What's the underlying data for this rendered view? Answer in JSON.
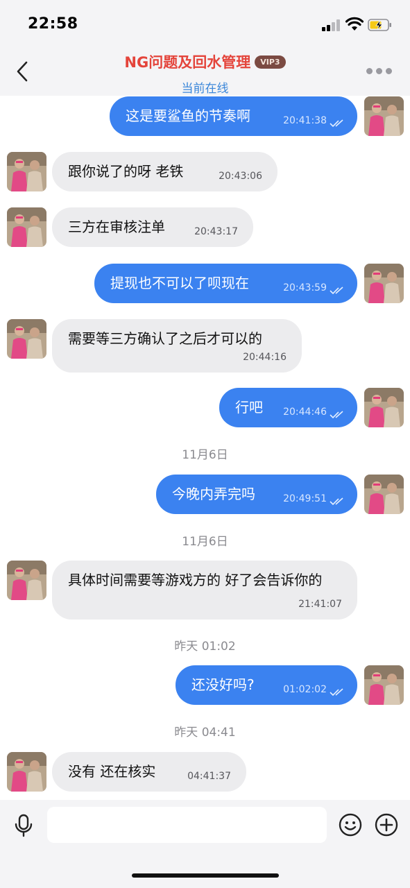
{
  "status_bar": {
    "time": "22:58"
  },
  "header": {
    "title": "NG问题及回水管理",
    "badge": "VIP3",
    "subtitle": "当前在线"
  },
  "messages": [
    {
      "side": "out",
      "text": "这是要鲨鱼的节奏啊",
      "time": "20:41:38",
      "status_icon": "double-check-icon"
    },
    {
      "side": "in",
      "text": "跟你说了的呀  老铁",
      "time": "20:43:06"
    },
    {
      "side": "in",
      "text": "三方在审核注单",
      "time": "20:43:17"
    },
    {
      "side": "out",
      "text": "提现也不可以了呗现在",
      "time": "20:43:59",
      "status_icon": "double-check-icon"
    },
    {
      "side": "in",
      "text": "需要等三方确认了之后才可以的",
      "time": "20:44:16"
    },
    {
      "side": "out",
      "text": "行吧",
      "time": "20:44:46",
      "status_icon": "double-check-icon"
    },
    {
      "type": "date",
      "text": "11月6日"
    },
    {
      "side": "out",
      "text": "今晚内弄完吗",
      "time": "20:49:51",
      "status_icon": "double-check-icon"
    },
    {
      "type": "date",
      "text": "11月6日"
    },
    {
      "side": "in",
      "text": "具体时间需要等游戏方的  好了会告诉你的",
      "time": "21:41:07"
    },
    {
      "type": "date",
      "text": "昨天 01:02"
    },
    {
      "side": "out",
      "text": "还没好吗?",
      "time": "01:02:02",
      "status_icon": "double-check-icon"
    },
    {
      "type": "date",
      "text": "昨天 04:41"
    },
    {
      "side": "in",
      "text": "没有  还在核实",
      "time": "04:41:37"
    }
  ],
  "input_bar": {
    "placeholder": "",
    "value": ""
  },
  "colors": {
    "accent": "#3b82f0",
    "title_red": "#e4443b",
    "online_blue": "#3a86d9",
    "incoming_bubble": "#ececee"
  }
}
